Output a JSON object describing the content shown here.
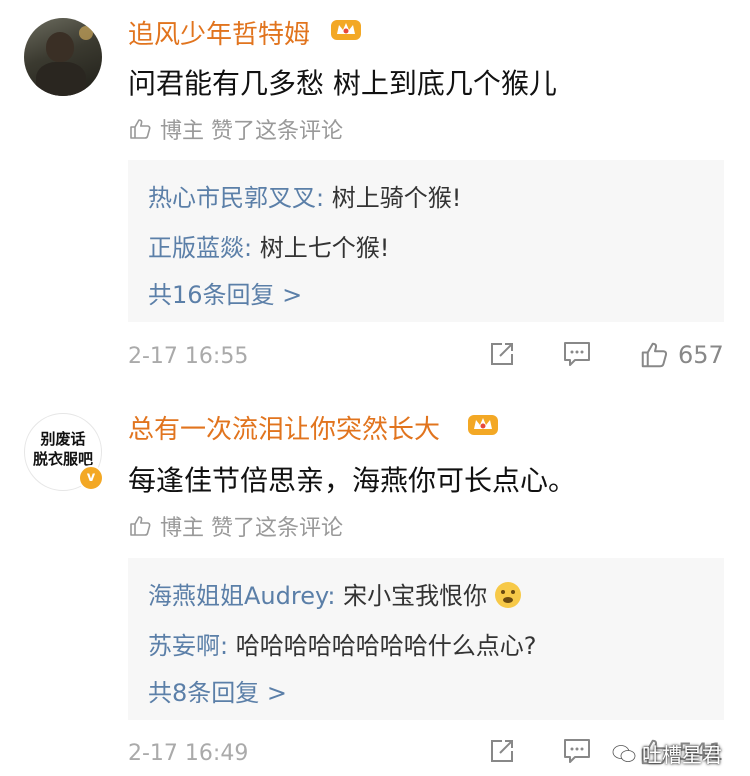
{
  "comments": [
    {
      "username": "追风少年哲特姆",
      "text": "问君能有几多愁 树上到底几个猴儿",
      "liked_by_author": "博主 赞了这条评论",
      "replies": [
        {
          "name": "热心市民郭叉叉:",
          "text": " 树上骑个猴!"
        },
        {
          "name": "正版蓝燚:",
          "text": " 树上七个猴!"
        }
      ],
      "more_replies": "共16条回复 >",
      "time": "2-17 16:55",
      "likes": "657"
    },
    {
      "username": "总有一次流泪让你突然长大",
      "avatar_line1": "别废话",
      "avatar_line2": "脱衣服吧",
      "verified_mark": "v",
      "text": "每逢佳节倍思亲，海燕你可长点心。",
      "liked_by_author": "博主 赞了这条评论",
      "replies": [
        {
          "name": "海燕姐姐Audrey:",
          "text": " 宋小宝我恨你",
          "emoji": "smile-emoji"
        },
        {
          "name": "苏妄啊:",
          "text": " 哈哈哈哈哈哈哈哈什么点心?"
        }
      ],
      "more_replies": "共8条回复 >",
      "time": "2-17 16:49",
      "likes": "541"
    }
  ],
  "watermark": "吐槽星君",
  "icons": {
    "crown": "crown-icon",
    "thumb": "thumbs-up-icon",
    "share": "share-icon",
    "reply": "comment-icon"
  },
  "colors": {
    "username": "#e1741e",
    "reply_name": "#5b7fa8",
    "meta": "#aaaaaa",
    "reply_bg": "#f7f7f7"
  }
}
